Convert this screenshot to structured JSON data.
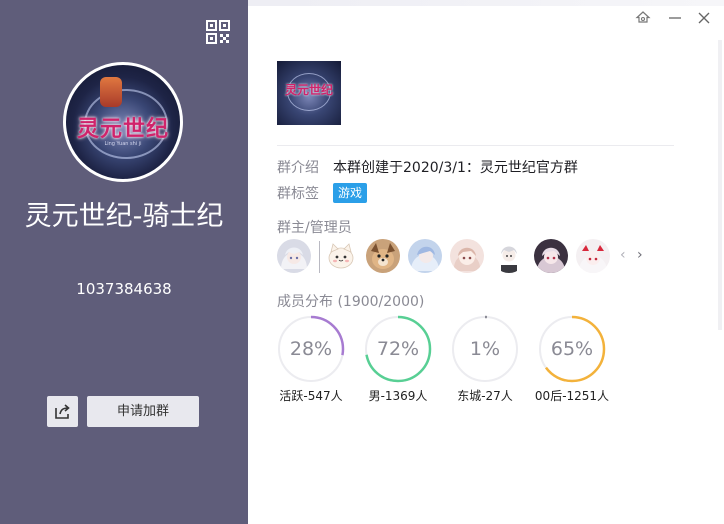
{
  "group": {
    "name": "灵元世纪-骑士纪",
    "id": "1037384638",
    "avatar_logo_text": "灵元世纪",
    "avatar_sub_text": "Ling Yuan shi ji"
  },
  "actions": {
    "join_label": "申请加群"
  },
  "info": {
    "intro_label": "群介绍",
    "intro_value": "本群创建于2020/3/1：灵元世纪官方群",
    "tag_label": "群标签",
    "tag_value": "游戏",
    "tag_color": "#2b9fe8",
    "admins_label": "群主/管理员"
  },
  "admins": [
    {
      "icon": "anime-girl-white-hair"
    },
    {
      "icon": "cartoon-cat"
    },
    {
      "icon": "dog"
    },
    {
      "icon": "anime-girl-blue"
    },
    {
      "icon": "anime-girl-pink"
    },
    {
      "icon": "anime-boy-white-hair"
    },
    {
      "icon": "anime-girl-dark"
    },
    {
      "icon": "anime-girl-red"
    }
  ],
  "members": {
    "label": "成员分布 (1900/2000)",
    "stats": [
      {
        "pct_label": "28%",
        "value": 0.28,
        "caption": "活跃-547人",
        "color": "#a77bd1"
      },
      {
        "pct_label": "72%",
        "value": 0.72,
        "caption": "男-1369人",
        "color": "#58cf94"
      },
      {
        "pct_label": "1%",
        "value": 0.01,
        "caption": "东城-27人",
        "color": "#8a8a94"
      },
      {
        "pct_label": "65%",
        "value": 0.65,
        "caption": "00后-1251人",
        "color": "#f3b23b"
      }
    ]
  },
  "colors": {
    "sidebar": "#5f5d7a",
    "ring_track": "#ececf0"
  }
}
